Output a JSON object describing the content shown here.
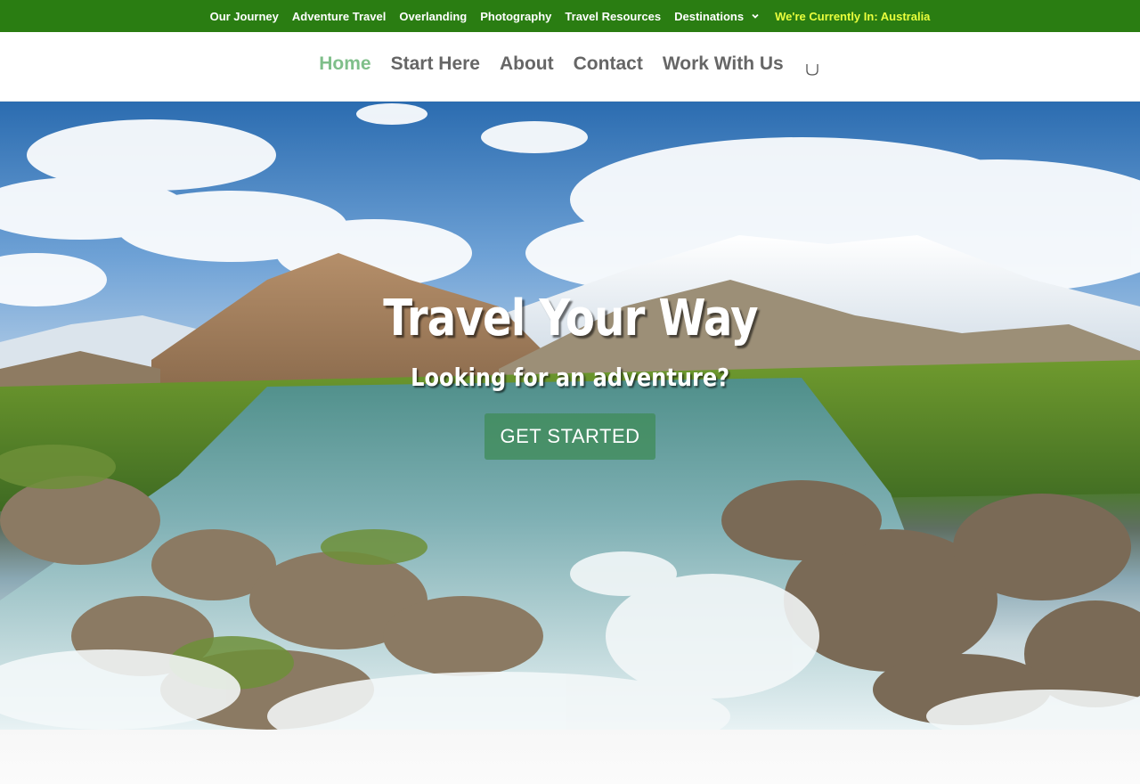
{
  "topbar": {
    "links": [
      {
        "label": "Our Journey"
      },
      {
        "label": "Adventure Travel"
      },
      {
        "label": "Overlanding"
      },
      {
        "label": "Photography"
      },
      {
        "label": "Travel Resources"
      },
      {
        "label": "Destinations"
      }
    ],
    "status": "We're Currently In: Australia",
    "colors": {
      "background": "#2a7d12",
      "highlight": "#e9ff3d"
    }
  },
  "mainnav": {
    "items": [
      {
        "label": "Home",
        "active": true
      },
      {
        "label": "Start Here"
      },
      {
        "label": "About"
      },
      {
        "label": "Contact"
      },
      {
        "label": "Work With Us"
      }
    ],
    "search_icon": "search-icon",
    "colors": {
      "active": "#7fbf8a",
      "default": "#666666"
    }
  },
  "hero": {
    "title": "Travel Your Way",
    "subtitle": "Looking for an adventure?",
    "cta_label": "GET STARTED",
    "cta_color": "#408c5a"
  }
}
